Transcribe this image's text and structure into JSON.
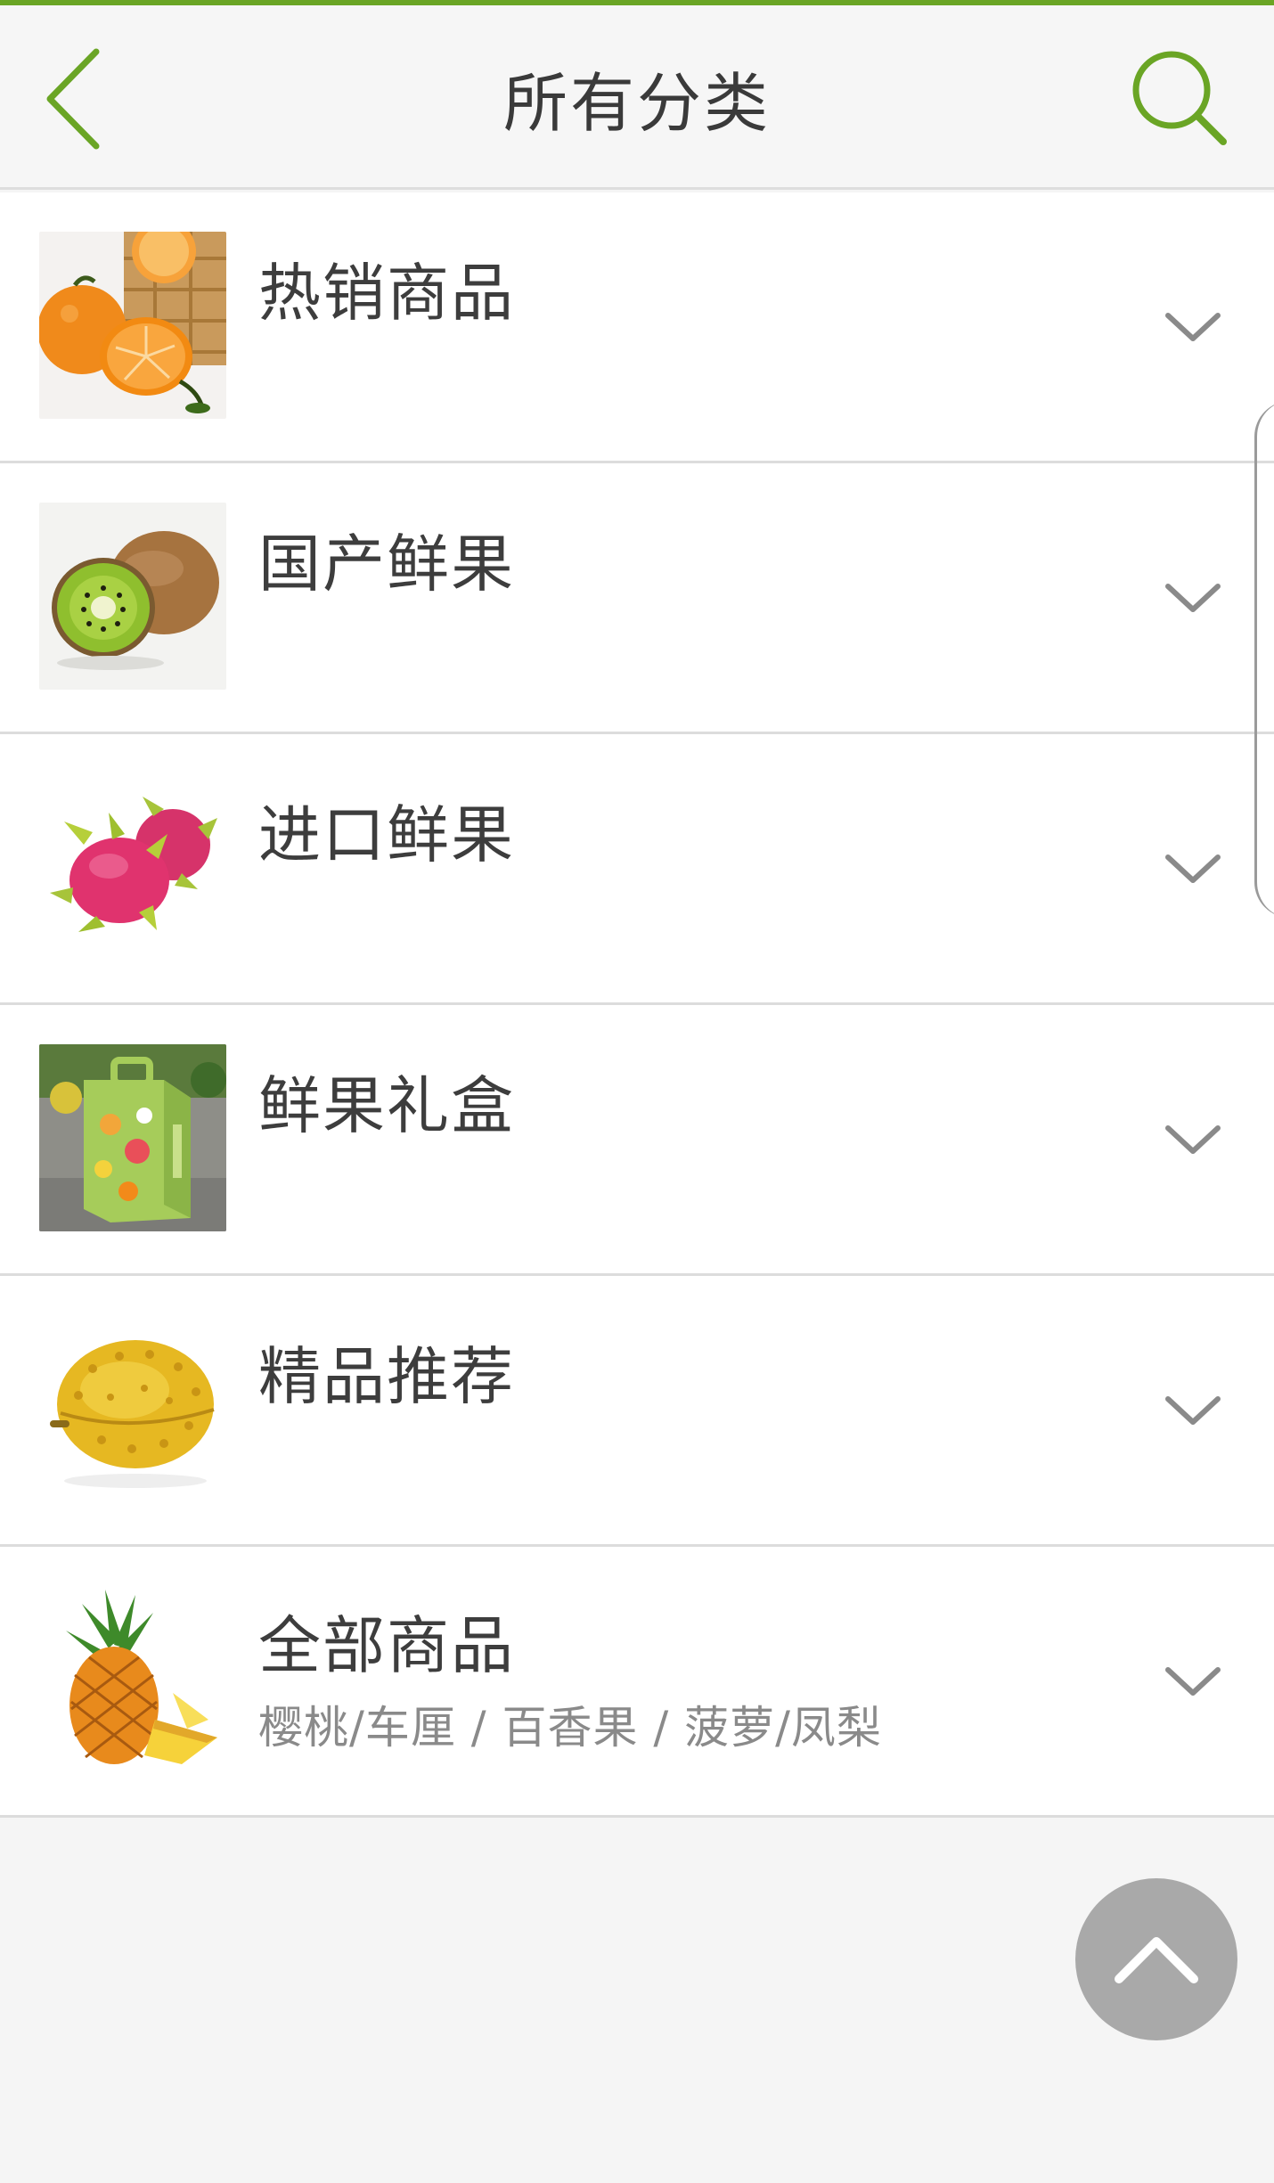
{
  "header": {
    "title": "所有分类",
    "back_icon": "chevron-left-icon",
    "search_icon": "search-icon",
    "accent_color": "#6aa525"
  },
  "categories": [
    {
      "label": "热销商品",
      "image": "tangerine-image"
    },
    {
      "label": "国产鲜果",
      "image": "kiwi-image"
    },
    {
      "label": "进口鲜果",
      "image": "dragon-fruit-image"
    },
    {
      "label": "鲜果礼盒",
      "image": "fruit-gift-box-image"
    },
    {
      "label": "精品推荐",
      "image": "durian-image"
    },
    {
      "label": "全部商品",
      "sublabel": "樱桃/车厘 / 百香果 / 菠萝/凤梨",
      "image": "pineapple-image"
    }
  ],
  "expand_icon": "chevron-down-icon",
  "back_to_top_icon": "chevron-up-icon"
}
